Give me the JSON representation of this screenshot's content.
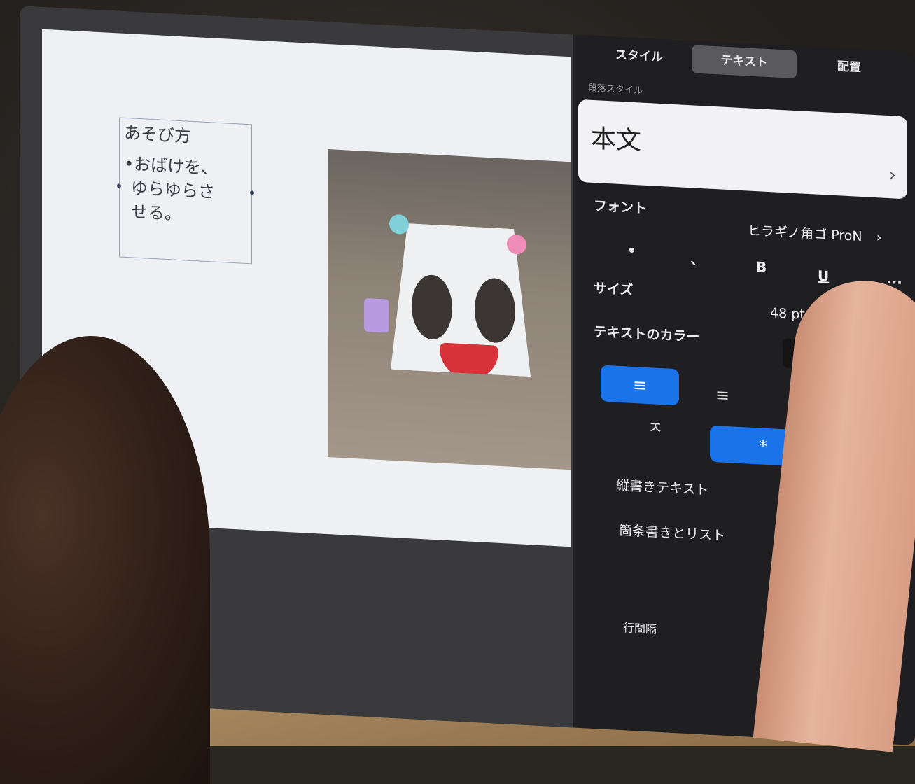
{
  "slide": {
    "textbox": {
      "title": "あそび方",
      "line1": "•おばけを、",
      "line2": "ゆらゆらさ",
      "line3": "せる。"
    }
  },
  "panel": {
    "tabs": [
      {
        "label": "スタイル",
        "active": false
      },
      {
        "label": "テキスト",
        "active": true
      },
      {
        "label": "配置",
        "active": false
      }
    ],
    "paragraph_style_label": "段落スタイル",
    "paragraph_style_value": "本文",
    "font_label": "フォント",
    "font_value": "ヒラギノ角ゴ ProN",
    "format_buttons": {
      "dot": "•",
      "comma": "、",
      "bold": "B",
      "underline": "U",
      "more": "···"
    },
    "size_label": "サイズ",
    "size_value": "48 pt",
    "size_minus": "−",
    "size_plus": "+",
    "text_color_label": "テキストのカラー",
    "align": {
      "left": "≡",
      "center": "≡",
      "right": "≡",
      "top": "ㅈ",
      "middle": "*"
    },
    "vertical_text_label": "縦書きテキスト",
    "bullets_label": "箇条書きとリスト",
    "line_spacing_label": "行間隔"
  },
  "colors": {
    "accent": "#1a73e8",
    "panel_bg": "#1f1f21",
    "slide_bg": "#eef0f4"
  }
}
